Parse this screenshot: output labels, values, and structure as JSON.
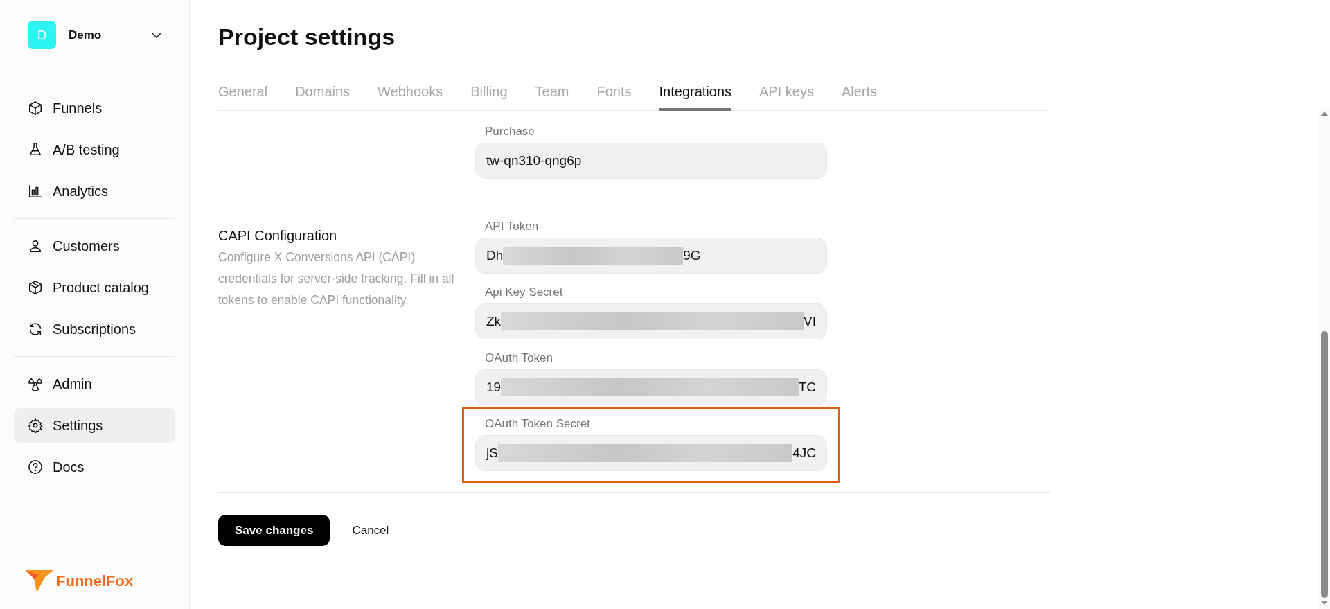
{
  "workspace": {
    "initial": "D",
    "name": "Demo"
  },
  "nav_groups": [
    [
      {
        "label": "Funnels",
        "selected": false
      },
      {
        "label": "A/B testing",
        "selected": false
      },
      {
        "label": "Analytics",
        "selected": false
      }
    ],
    [
      {
        "label": "Customers",
        "selected": false
      },
      {
        "label": "Product catalog",
        "selected": false
      },
      {
        "label": "Subscriptions",
        "selected": false
      }
    ],
    [
      {
        "label": "Admin",
        "selected": false
      },
      {
        "label": "Settings",
        "selected": true
      },
      {
        "label": "Docs",
        "selected": false
      }
    ]
  ],
  "logo": {
    "text": "FunnelFox"
  },
  "page": {
    "title": "Project settings"
  },
  "tabs": [
    {
      "label": "General",
      "selected": false
    },
    {
      "label": "Domains",
      "selected": false
    },
    {
      "label": "Webhooks",
      "selected": false
    },
    {
      "label": "Billing",
      "selected": false
    },
    {
      "label": "Team",
      "selected": false
    },
    {
      "label": "Fonts",
      "selected": false
    },
    {
      "label": "Integrations",
      "selected": true
    },
    {
      "label": "API keys",
      "selected": false
    },
    {
      "label": "Alerts",
      "selected": false
    }
  ],
  "sections": [
    {
      "fields": [
        {
          "label": "Purchase",
          "value": "tw-qn310-qng6p",
          "highlighted": false
        }
      ]
    },
    {
      "title": "CAPI Configuration",
      "description": "Configure X Conversions API (CAPI) credentials for server-side tracking. Fill in all tokens to enable CAPI functionality.",
      "fields": [
        {
          "label": "API Token",
          "value": "Dh",
          "value_end": "9G",
          "kind": "short",
          "highlighted": false
        },
        {
          "label": "Api Key Secret",
          "value": "Zk",
          "value_end": "VI",
          "kind": "long",
          "highlighted": false
        },
        {
          "label": "OAuth Token",
          "value": "19",
          "value_end": "TC",
          "kind": "long",
          "highlighted": false
        },
        {
          "label": "OAuth Token Secret",
          "value": "jS",
          "value_end": "4JC",
          "kind": "long",
          "highlighted": true
        }
      ]
    }
  ],
  "actions": {
    "primary": "Save changes",
    "secondary": "Cancel"
  }
}
